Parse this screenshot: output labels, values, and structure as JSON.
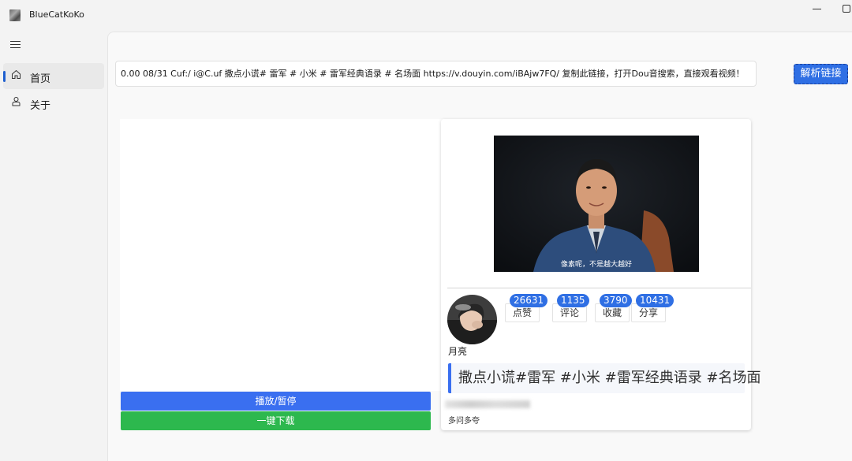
{
  "app": {
    "title": "BlueCatKoKo"
  },
  "nav": {
    "items": [
      {
        "label": "首页",
        "icon": "home-icon",
        "active": true
      },
      {
        "label": "关于",
        "icon": "user-icon",
        "active": false
      }
    ]
  },
  "main": {
    "url_input_value": "0.00 08/31 Cuf:/ i@C.uf 撒点小谎# 雷军 # 小米 # 雷军经典语录 # 名场面  https://v.douyin.com/iBAjw7FQ/ 复制此链接，打开Dou音搜索，直接观看视频！",
    "parse_button": "解析链接",
    "play_button": "播放/暂停",
    "download_button": "一键下载"
  },
  "video": {
    "subtitle": "像素呢，不是越大越好",
    "author": "月亮",
    "stats": [
      {
        "count": "26631",
        "label": "点赞"
      },
      {
        "count": "1135",
        "label": "评论"
      },
      {
        "count": "3790",
        "label": "收藏"
      },
      {
        "count": "10431",
        "label": "分享"
      }
    ],
    "description": "撒点小谎#雷军 #小米 #雷军经典语录 #名场面",
    "footer": "多问多夸"
  },
  "colors": {
    "accent": "#2f6fe4",
    "play_button": "#3a6ff0",
    "download_button": "#2db84e"
  }
}
